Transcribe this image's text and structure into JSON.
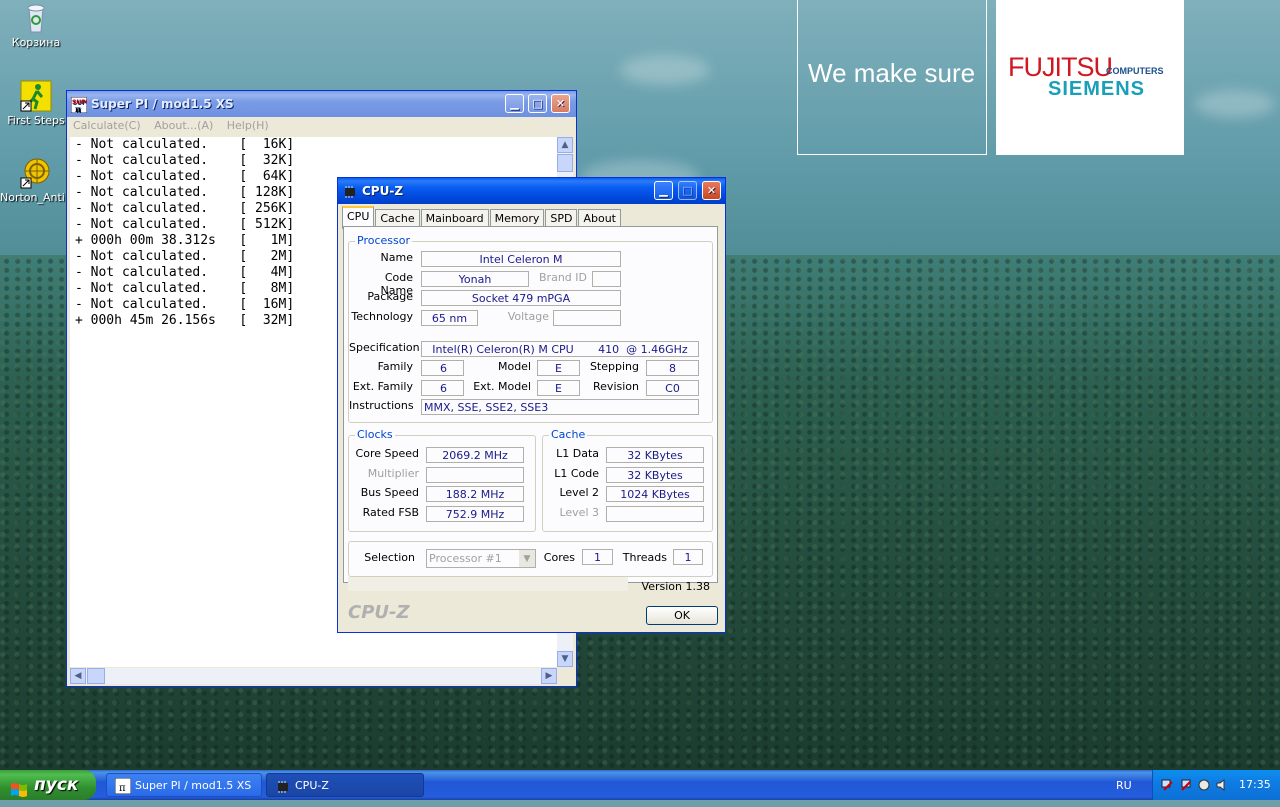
{
  "desktop": {
    "icons": [
      {
        "label": "Корзина",
        "icon": "recycle-bin-icon"
      },
      {
        "label": "First Steps",
        "icon": "first-steps-icon"
      },
      {
        "label": "Norton_Anti...",
        "icon": "norton-antivirus-icon"
      }
    ],
    "banner": {
      "slogan": "We make sure",
      "brand": "FUJITSU",
      "brand_sub": "COMPUTERS",
      "brand2": "SIEMENS"
    }
  },
  "superpi": {
    "title": "Super PI / mod1.5 XS",
    "menu": [
      "Calculate(C)",
      "About...(A)",
      "Help(H)"
    ],
    "lines": [
      "- Not calculated.    [  16K]",
      "- Not calculated.    [  32K]",
      "- Not calculated.    [  64K]",
      "- Not calculated.    [ 128K]",
      "- Not calculated.    [ 256K]",
      "- Not calculated.    [ 512K]",
      "+ 000h 00m 38.312s   [   1M]",
      "- Not calculated.    [   2M]",
      "- Not calculated.    [   4M]",
      "- Not calculated.    [   8M]",
      "- Not calculated.    [  16M]",
      "+ 000h 45m 26.156s   [  32M]"
    ]
  },
  "cpuz": {
    "title": "CPU-Z",
    "tabs": [
      "CPU",
      "Cache",
      "Mainboard",
      "Memory",
      "SPD",
      "About"
    ],
    "processor": {
      "group": "Processor",
      "name_label": "Name",
      "name": "Intel Celeron M",
      "codename_label": "Code Name",
      "codename": "Yonah",
      "brandid_label": "Brand ID",
      "brandid": "",
      "package_label": "Package",
      "package": "Socket 479 mPGA",
      "technology_label": "Technology",
      "technology": "65 nm",
      "voltage_label": "Voltage",
      "voltage": "",
      "spec_label": "Specification",
      "spec": "Intel(R) Celeron(R) M CPU       410  @ 1.46GHz",
      "family_label": "Family",
      "family": "6",
      "model_label": "Model",
      "model": "E",
      "stepping_label": "Stepping",
      "stepping": "8",
      "extfamily_label": "Ext. Family",
      "extfamily": "6",
      "extmodel_label": "Ext. Model",
      "extmodel": "E",
      "revision_label": "Revision",
      "revision": "C0",
      "instructions_label": "Instructions",
      "instructions": "MMX, SSE, SSE2, SSE3"
    },
    "clocks": {
      "group": "Clocks",
      "core_label": "Core Speed",
      "core": "2069.2 MHz",
      "mult_label": "Multiplier",
      "mult": "",
      "bus_label": "Bus Speed",
      "bus": "188.2 MHz",
      "fsb_label": "Rated FSB",
      "fsb": "752.9 MHz"
    },
    "cache": {
      "group": "Cache",
      "l1d_label": "L1 Data",
      "l1d": "32 KBytes",
      "l1c_label": "L1 Code",
      "l1c": "32 KBytes",
      "l2_label": "Level 2",
      "l2": "1024 KBytes",
      "l3_label": "Level 3",
      "l3": ""
    },
    "selection_label": "Selection",
    "selection": "Processor #1",
    "cores_label": "Cores",
    "cores": "1",
    "threads_label": "Threads",
    "threads": "1",
    "version": "Version 1.38",
    "logo": "CPU-Z",
    "ok": "OK"
  },
  "taskbar": {
    "start": "пуск",
    "items": [
      "Super PI / mod1.5 XS",
      "CPU-Z"
    ],
    "lang": "RU",
    "clock": "17:35"
  }
}
